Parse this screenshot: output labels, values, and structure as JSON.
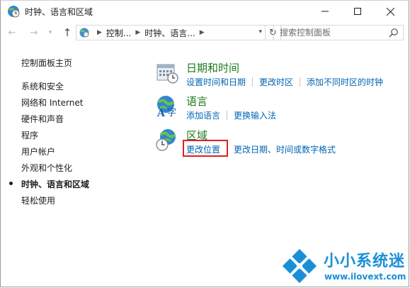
{
  "window": {
    "title": "时钟、语言和区域"
  },
  "address_bar": {
    "crumbs": [
      "控制...",
      "时钟、语言..."
    ],
    "search_placeholder": "搜索控制面板"
  },
  "left_nav": {
    "home": "控制面板主页",
    "items": [
      {
        "label": "系统和安全"
      },
      {
        "label": "网络和 Internet"
      },
      {
        "label": "硬件和声音"
      },
      {
        "label": "程序"
      },
      {
        "label": "用户帐户"
      },
      {
        "label": "外观和个性化"
      },
      {
        "label": "时钟、语言和区域",
        "active": true
      },
      {
        "label": "轻松使用"
      }
    ]
  },
  "categories": [
    {
      "heading": "日期和时间",
      "icon": "calendar-clock-icon",
      "links": [
        "设置时间和日期",
        "更改时区",
        "添加不同时区的时钟"
      ]
    },
    {
      "heading": "语言",
      "icon": "language-icon",
      "links": [
        "添加语言",
        "更换输入法"
      ]
    },
    {
      "heading": "区域",
      "icon": "region-globe-icon",
      "links": [
        "更改位置",
        "更改日期、时间或数字格式"
      ]
    }
  ],
  "highlight": {
    "target": "更改位置",
    "color": "#e02020"
  },
  "watermark": {
    "title": "小小系统迷",
    "url": "www.ilovext.com"
  },
  "colors": {
    "link": "#0064b4",
    "heading": "#1e7a1e",
    "watermark": "#1a8fd6"
  }
}
